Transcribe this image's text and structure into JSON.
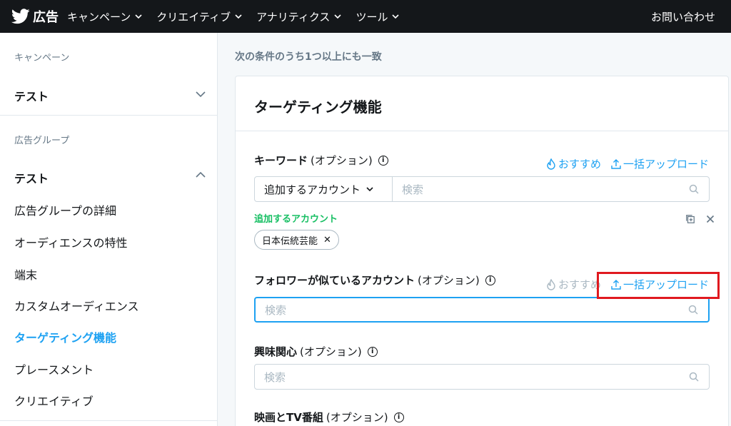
{
  "topbar": {
    "logo_label": "広告",
    "nav": [
      "キャンペーン",
      "クリエイティブ",
      "アナリティクス",
      "ツール"
    ],
    "help": "お問い合わせ"
  },
  "sidebar": {
    "campaign_heading": "キャンペーン",
    "campaign_name": "テスト",
    "adgroup_heading": "広告グループ",
    "adgroup_name": "テスト",
    "items": [
      "広告グループの詳細",
      "オーディエンスの特性",
      "端末",
      "カスタムオーディエンス",
      "ターゲティング機能",
      "プレースメント",
      "クリエイティブ"
    ],
    "active_item": "ターゲティング機能"
  },
  "main": {
    "heading": "次の条件のうち1つ以上にも一致",
    "card_title": "ターゲティング機能",
    "keyword": {
      "label": "キーワード",
      "optional": "(オプション)",
      "recommend": "おすすめ",
      "bulk_upload": "一括アップロード",
      "dropdown": "追加するアカウント",
      "placeholder": "検索",
      "added_label": "追加するアカウント",
      "chip": "日本伝統芸能"
    },
    "follower": {
      "label": "フォロワーが似ているアカウント",
      "optional": "(オプション)",
      "recommend": "おすすめ",
      "bulk_upload": "一括アップロード",
      "placeholder": "検索"
    },
    "interest": {
      "label": "興味関心",
      "optional": "(オプション)",
      "placeholder": "検索"
    },
    "movies": {
      "label": "映画とTV番組",
      "optional": "(オプション)"
    }
  },
  "colors": {
    "accent": "#1da1f2",
    "topbar": "#14171a",
    "green": "#17bf63",
    "highlight": "#e0191f"
  }
}
